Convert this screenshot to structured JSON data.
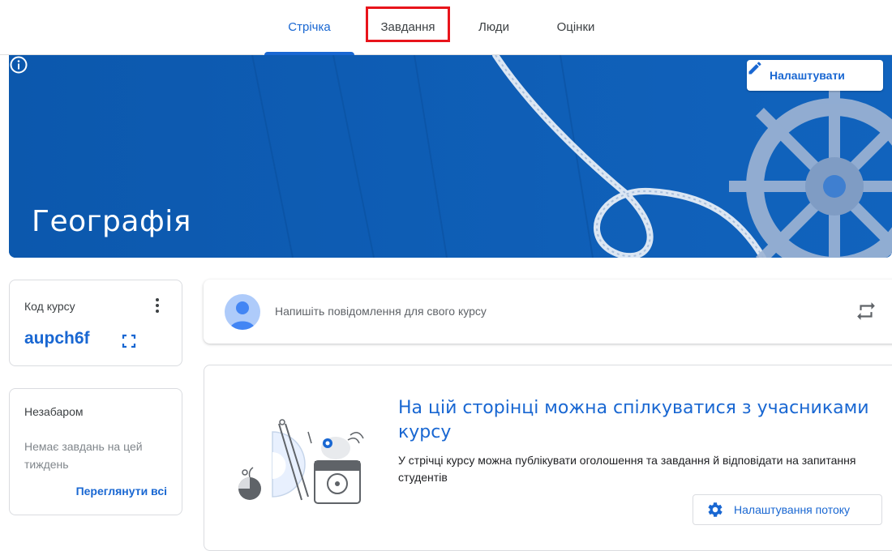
{
  "nav": {
    "tabs": [
      {
        "label": "Стрічка",
        "active": true
      },
      {
        "label": "Завдання",
        "active": false,
        "highlighted": true
      },
      {
        "label": "Люди",
        "active": false
      },
      {
        "label": "Оцінки",
        "active": false
      }
    ]
  },
  "banner": {
    "course_title": "Географія",
    "customize_label": "Налаштувати",
    "customize_icon": "pencil-icon",
    "info_icon": "info-icon",
    "color": "#0d5bb3"
  },
  "class_code": {
    "label": "Код курсу",
    "value": "aupch6f",
    "more_icon": "more-vert-icon",
    "expand_icon": "fullscreen-icon"
  },
  "upcoming": {
    "title": "Незабаром",
    "empty_text": "Немає завдань на цей тиждень",
    "view_all": "Переглянути всі"
  },
  "post_box": {
    "placeholder": "Напишіть повідомлення для свого курсу",
    "repost_icon": "repost-icon"
  },
  "stream_info": {
    "title": "На цій сторінці можна спілкуватися з учасниками курсу",
    "description": "У стрічці курсу можна публікувати оголошення та завдання й відповідати на запитання студентів",
    "settings_button": "Налаштування потоку",
    "settings_icon": "gear-icon"
  },
  "colors": {
    "accent": "#1967d2",
    "highlight": "#e8141b"
  }
}
